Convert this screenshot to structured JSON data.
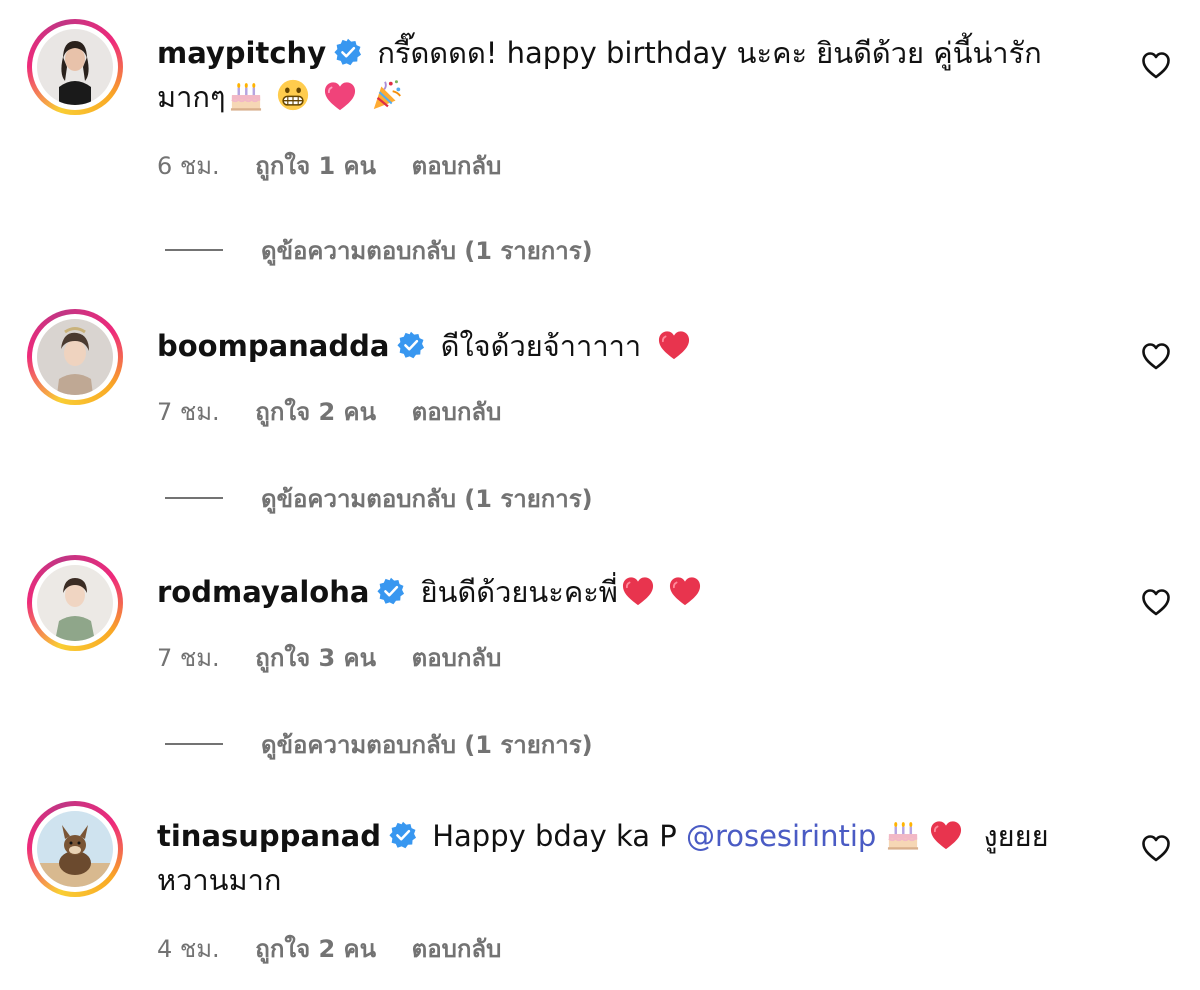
{
  "comments": [
    {
      "username": "maypitchy",
      "verified": true,
      "text_parts": [
        "กรี๊ดดดด! happy birthday นะคะ ยินดีด้วย คู่นี้น่ารัก มากๆ"
      ],
      "emojis": [
        "birthday-cake",
        "grimacing-face",
        "pink-heart",
        "party-popper"
      ],
      "time": "6 ชม.",
      "likes": "ถูกใจ 1 คน",
      "reply_label": "ตอบกลับ",
      "view_replies": "ดูข้อความตอบกลับ (1 รายการ)"
    },
    {
      "username": "boompanadda",
      "verified": true,
      "text": "ดีใจด้วยจ้าาาาา",
      "emojis": [
        "red-heart"
      ],
      "time": "7 ชม.",
      "likes": "ถูกใจ 2 คน",
      "reply_label": "ตอบกลับ",
      "view_replies": "ดูข้อความตอบกลับ (1 รายการ)"
    },
    {
      "username": "rodmayaloha",
      "verified": true,
      "text": "ยินดีด้วยนะคะพี่",
      "emojis": [
        "red-heart",
        "red-heart"
      ],
      "time": "7 ชม.",
      "likes": "ถูกใจ 3 คน",
      "reply_label": "ตอบกลับ",
      "view_replies": "ดูข้อความตอบกลับ (1 รายการ)"
    },
    {
      "username": "tinasuppanad",
      "verified": true,
      "text_before": "Happy bday ka P",
      "mention": "@rosesirintip",
      "text_after": "งูยยย",
      "text_line2": "หวานมาก",
      "emojis": [
        "birthday-cake",
        "red-heart"
      ],
      "time": "4 ชม.",
      "likes": "ถูกใจ 2 คน",
      "reply_label": "ตอบกลับ"
    }
  ],
  "colors": {
    "verified_blue": "#3897f0",
    "mention_blue": "#4a5bc4",
    "meta_gray": "#737373",
    "heart_red": "#e8344e"
  },
  "icons": {
    "like": "heart-outline-icon",
    "verified": "verified-badge-icon"
  }
}
